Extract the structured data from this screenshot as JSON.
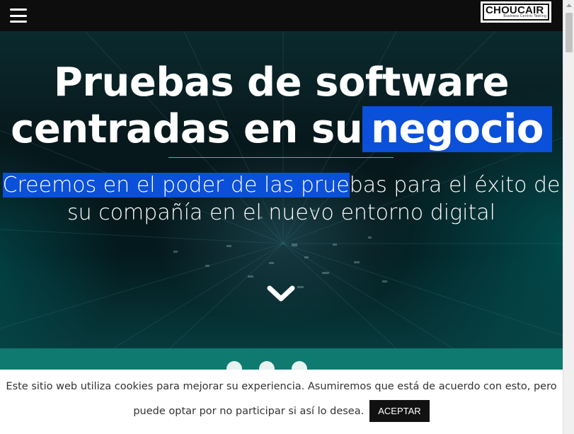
{
  "header": {
    "menu_icon": "hamburger-icon",
    "logo": {
      "name": "CHOUCAIR",
      "tagline": "Business Centric Testing"
    }
  },
  "hero": {
    "title_line1": "Pruebas de software",
    "title_line2_plain": "centradas en su",
    "title_line2_highlight": "negocio",
    "subtitle_highlight": "Creemos en el poder de las prue",
    "subtitle_rest": "bas para el éxito de",
    "subtitle_line2": "su compañía en el nuevo entorno digital",
    "scroll_icon": "chevron-down-icon",
    "colors": {
      "highlight": "#0a50d8",
      "divider": "#4fb6b0"
    }
  },
  "cookie_banner": {
    "text_line1": "Este sitio web utiliza cookies para mejorar su experiencia. Asumiremos que está de acuerdo con esto, pero",
    "text_line2": "puede optar por no participar si así lo desea.",
    "accept_label": "ACEPTAR"
  },
  "colors": {
    "social_band": "#0f7a70",
    "topbar": "#0d0d0d"
  }
}
